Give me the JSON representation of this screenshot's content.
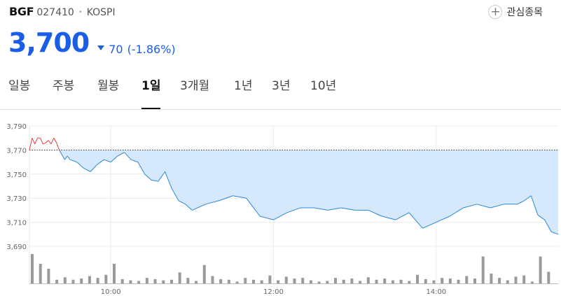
{
  "stock": {
    "ticker": "BGF",
    "code": "027410",
    "market": "KOSPI",
    "price": "3,700",
    "change": "70",
    "change_pct": "(-1.86%)",
    "direction": "down",
    "accent_color": "#1a5ee8",
    "up_color": "#e43c3c"
  },
  "watchlist": {
    "label": "관심종목",
    "icon": "plus-icon"
  },
  "tabs": [
    {
      "label": "일봉",
      "active": false
    },
    {
      "label": "주봉",
      "active": false
    },
    {
      "label": "월봉",
      "active": false
    },
    {
      "label": "1일",
      "active": true
    },
    {
      "label": "3개월",
      "active": false
    },
    {
      "label": "1년",
      "active": false
    },
    {
      "label": "3년",
      "active": false
    },
    {
      "label": "10년",
      "active": false
    }
  ],
  "chart_data": {
    "type": "line",
    "x_ticks": [
      "10:00",
      "12:00",
      "14:00"
    ],
    "y_ticks": [
      "3,790",
      "3,770",
      "3,750",
      "3,730",
      "3,710",
      "3,690"
    ],
    "ylim": [
      3690,
      3790
    ],
    "xlim": [
      "09:00",
      "15:30"
    ],
    "reference_price": 3770,
    "grid": true,
    "series": [
      {
        "x": [
          "09:00",
          "09:02",
          "09:04",
          "09:06",
          "09:08",
          "09:10",
          "09:12",
          "09:14",
          "09:16",
          "09:18",
          "09:20",
          "09:22",
          "09:24",
          "09:26",
          "09:28",
          "09:30",
          "09:35",
          "09:40",
          "09:45",
          "09:50",
          "09:55",
          "10:00",
          "10:05",
          "10:10",
          "10:15",
          "10:20",
          "10:25",
          "10:30",
          "10:35",
          "10:40",
          "10:45",
          "10:50",
          "10:55",
          "11:00",
          "11:10",
          "11:20",
          "11:30",
          "11:40",
          "11:50",
          "12:00",
          "12:10",
          "12:20",
          "12:30",
          "12:40",
          "12:50",
          "13:00",
          "13:10",
          "13:20",
          "13:30",
          "13:40",
          "13:50",
          "14:00",
          "14:10",
          "14:20",
          "14:30",
          "14:40",
          "14:50",
          "15:00",
          "15:05",
          "15:10",
          "15:15",
          "15:20",
          "15:25",
          "15:30"
        ],
        "values": [
          3770,
          3780,
          3775,
          3780,
          3780,
          3775,
          3776,
          3778,
          3775,
          3780,
          3776,
          3770,
          3766,
          3762,
          3765,
          3762,
          3760,
          3755,
          3752,
          3758,
          3762,
          3760,
          3765,
          3768,
          3762,
          3760,
          3750,
          3745,
          3744,
          3752,
          3738,
          3728,
          3725,
          3720,
          3725,
          3728,
          3732,
          3730,
          3715,
          3712,
          3718,
          3722,
          3722,
          3720,
          3722,
          3720,
          3720,
          3715,
          3712,
          3718,
          3705,
          3710,
          3715,
          3722,
          3725,
          3722,
          3725,
          3725,
          3728,
          3732,
          3716,
          3712,
          3702,
          3700
        ]
      }
    ],
    "volume": [
      48,
      32,
      24,
      6,
      10,
      6,
      8,
      12,
      9,
      14,
      32,
      7,
      5,
      4,
      9,
      7,
      5,
      6,
      18,
      9,
      4,
      30,
      12,
      7,
      6,
      3,
      9,
      6,
      5,
      13,
      5,
      11,
      8,
      9,
      5,
      3,
      4,
      9,
      6,
      8,
      4,
      10,
      6,
      8,
      5,
      6,
      4,
      14,
      7,
      5,
      9,
      8,
      6,
      12,
      8,
      44,
      16,
      9,
      5,
      11,
      13,
      3,
      44,
      19
    ]
  }
}
